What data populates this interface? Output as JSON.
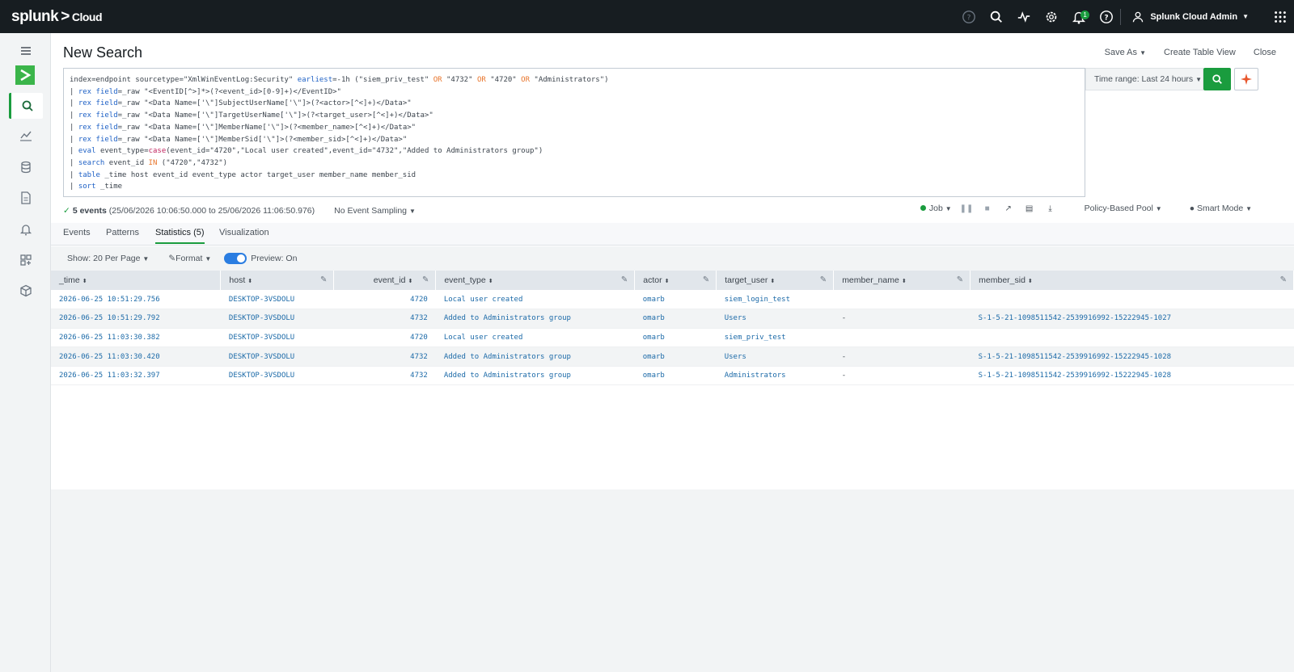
{
  "topbar": {
    "logo_main": "splunk",
    "logo_sep": ">",
    "logo_sub": "Cloud",
    "notification_count": "1",
    "user_name": "Splunk Cloud Admin",
    "icons": [
      "question-circle-icon",
      "search-icon",
      "activity-icon",
      "gear-icon",
      "bell-icon",
      "help-icon",
      "user-icon",
      "grid-apps-icon"
    ]
  },
  "page": {
    "title": "New Search",
    "save_as": "Save As",
    "create_table_view": "Create Table View",
    "close": "Close"
  },
  "search": {
    "lines": [
      "index=endpoint sourcetype=\"XmlWinEventLog:Security\" earliest=-1h (\"siem_priv_test\" OR \"4732\" OR \"4720\" OR \"Administrators\")",
      "| rex field=_raw \"<EventID[^>]*>(?<event_id>[0-9]+)</EventID>\"",
      "| rex field=_raw \"<Data Name=['\\\"]SubjectUserName['\\\"]>(?<actor>[^<]+)</Data>\"",
      "| rex field=_raw \"<Data Name=['\\\"]TargetUserName['\\\"]>(?<target_user>[^<]+)</Data>\"",
      "| rex field=_raw \"<Data Name=['\\\"]MemberName['\\\"]>(?<member_name>[^<]+)</Data>\"",
      "| rex field=_raw \"<Data Name=['\\\"]MemberSid['\\\"]>(?<member_sid>[^<]+)</Data>\"",
      "| eval event_type=case(event_id=\"4720\",\"Local user created\",event_id=\"4732\",\"Added to Administrators group\")",
      "| search event_id IN (\"4720\",\"4732\")",
      "| table _time host event_id event_type actor target_user member_name member_sid",
      "| sort _time"
    ],
    "time_range": "Time range: Last 24 hours"
  },
  "status": {
    "events": "5 events",
    "range": "(25/06/2026 10:06:50.000 to 25/06/2026 11:06:50.976)",
    "sampling": "No Event Sampling",
    "job": "Job",
    "pool": "Policy-Based Pool",
    "mode": "Smart Mode"
  },
  "tabs": {
    "events": "Events",
    "patterns": "Patterns",
    "statistics": "Statistics (5)",
    "visualization": "Visualization"
  },
  "toolbar": {
    "per_page": "Show: 20 Per Page",
    "format": "Format",
    "preview": "Preview: On"
  },
  "table": {
    "columns": [
      "_time",
      "host",
      "event_id",
      "event_type",
      "actor",
      "target_user",
      "member_name",
      "member_sid"
    ],
    "rows": [
      [
        "2026-06-25 10:51:29.756",
        "DESKTOP-3VSDOLU",
        "4720",
        "Local user created",
        "omarb",
        "siem_login_test",
        "",
        ""
      ],
      [
        "2026-06-25 10:51:29.792",
        "DESKTOP-3VSDOLU",
        "4732",
        "Added to Administrators group",
        "omarb",
        "Users",
        "-",
        "S-1-5-21-1098511542-2539916992-15222945-1027"
      ],
      [
        "2026-06-25 11:03:30.382",
        "DESKTOP-3VSDOLU",
        "4720",
        "Local user created",
        "omarb",
        "siem_priv_test",
        "",
        ""
      ],
      [
        "2026-06-25 11:03:30.420",
        "DESKTOP-3VSDOLU",
        "4732",
        "Added to Administrators group",
        "omarb",
        "Users",
        "-",
        "S-1-5-21-1098511542-2539916992-15222945-1028"
      ],
      [
        "2026-06-25 11:03:32.397",
        "DESKTOP-3VSDOLU",
        "4732",
        "Added to Administrators group",
        "omarb",
        "Administrators",
        "-",
        "S-1-5-21-1098511542-2539916992-15222945-1028"
      ]
    ]
  },
  "colors": {
    "brand_green": "#1a9c3e",
    "topbar_bg": "#171d21",
    "link_blue": "#1c6aa8"
  }
}
